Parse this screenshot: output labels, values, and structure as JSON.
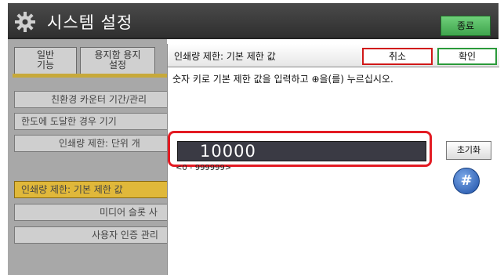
{
  "header": {
    "title": "시스템 설정",
    "exit_label": "종료"
  },
  "background": {
    "tabs": [
      {
        "label": "일반\n기능"
      },
      {
        "label": "용지함 용지\n설정"
      }
    ],
    "rows": [
      {
        "label": "친환경 카운터 기간/관리"
      },
      {
        "label": "한도에 도달한 경우 기기"
      },
      {
        "label": "인쇄량 제한: 단위 개"
      },
      {
        "label": "인쇄량 제한: 기본 제한 값",
        "selected": true
      },
      {
        "label": "미디어 슬롯 사"
      },
      {
        "label": "사용자 인증 관리"
      }
    ]
  },
  "dialog": {
    "title": "인쇄량 제한: 기본 제한 값",
    "cancel_label": "취소",
    "ok_label": "확인",
    "instruction": "숫자 키로 기본 제한 값을 입력하고 ⊕을(를) 누르십시오.",
    "value": "10000",
    "range": "<0 - 999999>",
    "reset_label": "초기화",
    "hash_label": "#"
  },
  "colors": {
    "highlight": "#e31b23",
    "cancel_border": "#d01818",
    "ok_border": "#2a9a3a",
    "selected_row": "#e0b83a"
  },
  "icons": {
    "settings": "gear-icon",
    "enter": "hash-key-icon"
  }
}
